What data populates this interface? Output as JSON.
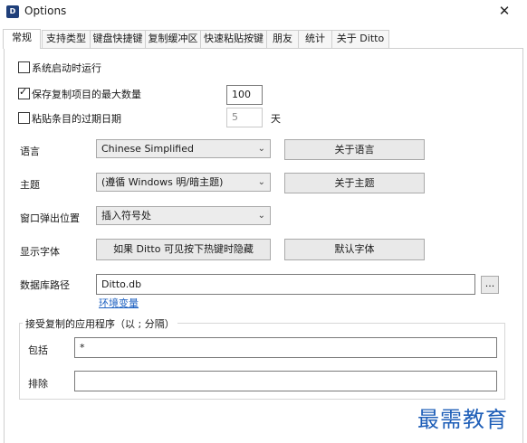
{
  "window": {
    "title": "Options",
    "close_glyph": "✕",
    "icon_glyph": "D"
  },
  "tabs": [
    "常规",
    "支持类型",
    "键盘快捷键",
    "复制缓冲区",
    "快速粘贴按键",
    "朋友",
    "统计",
    "关于 Ditto"
  ],
  "active_tab": "常规",
  "general": {
    "start_on_boot": {
      "label": "系统启动时运行",
      "checked": false
    },
    "max_saved": {
      "label": "保存复制项目的最大数量",
      "checked": true,
      "value": "100"
    },
    "expire": {
      "label": "粘贴条目的过期日期",
      "checked": false,
      "value": "5",
      "unit": "天"
    },
    "language": {
      "label": "语言",
      "selected": "Chinese Simplified",
      "button": "关于语言"
    },
    "theme": {
      "label": "主题",
      "selected": "(遵循 Windows 明/暗主题)",
      "button": "关于主题"
    },
    "popup_position": {
      "label": "窗口弹出位置",
      "selected": "插入符号处"
    },
    "font": {
      "label": "显示字体",
      "button": "如果 Ditto 可见按下热键时隐藏",
      "default_button": "默认字体"
    },
    "db_path": {
      "label": "数据库路径",
      "value": "Ditto.db",
      "browse": "...",
      "env_link": "环境变量"
    },
    "accepted_apps": {
      "title": "接受复制的应用程序（以 ; 分隔）",
      "include_label": "包括",
      "include_value": "*",
      "exclude_label": "排除",
      "exclude_value": ""
    }
  },
  "watermark": "最需教育"
}
